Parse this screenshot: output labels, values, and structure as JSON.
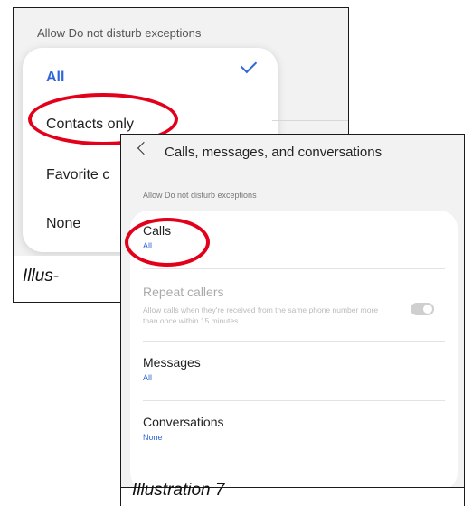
{
  "left_screenshot": {
    "header": "Allow Do not disturb exceptions",
    "options": [
      "All",
      "Contacts only",
      "Favorite c",
      "None"
    ],
    "selected": "All",
    "caption": "Illus-",
    "stray_mark": "o"
  },
  "right_screenshot": {
    "nav_title": "Calls, messages, and conversations",
    "section_header": "Allow Do not disturb exceptions",
    "rows": [
      {
        "title": "Calls",
        "value": "All"
      },
      {
        "title": "Repeat callers",
        "description": "Allow calls when they're received from the same phone number more than once within 15 minutes."
      },
      {
        "title": "Messages",
        "value": "All"
      },
      {
        "title": "Conversations",
        "value": "None"
      }
    ],
    "caption": "Illustration 7"
  },
  "colors": {
    "accent": "#2f66d8",
    "highlight_ring": "#e2001a"
  }
}
